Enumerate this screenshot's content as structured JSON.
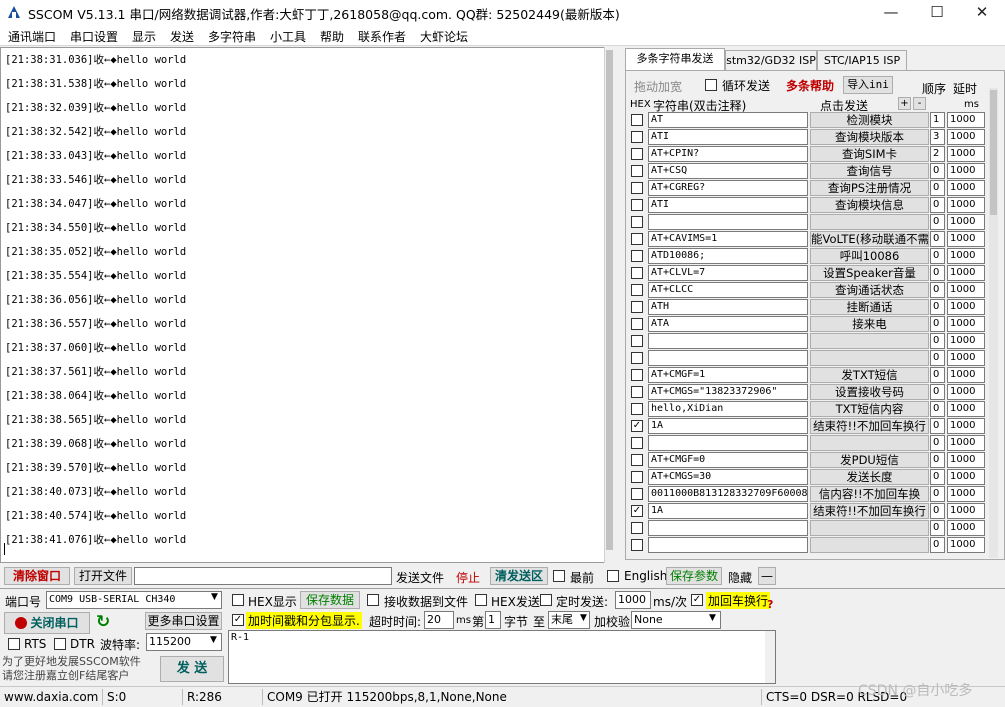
{
  "window": {
    "title": "SSCOM V5.13.1 串口/网络数据调试器,作者:大虾丁丁,2618058@qq.com. QQ群: 52502449(最新版本)",
    "minimize": "—",
    "maximize": "☐",
    "close": "✕"
  },
  "menu": [
    "通讯端口",
    "串口设置",
    "显示",
    "发送",
    "多字符串",
    "小工具",
    "帮助",
    "联系作者",
    "大虾论坛"
  ],
  "receive": {
    "lines": [
      "[21:38:31.036]收←◆hello world",
      "[21:38:31.538]收←◆hello world",
      "[21:38:32.039]收←◆hello world",
      "[21:38:32.542]收←◆hello world",
      "[21:38:33.043]收←◆hello world",
      "[21:38:33.546]收←◆hello world",
      "[21:38:34.047]收←◆hello world",
      "[21:38:34.550]收←◆hello world",
      "[21:38:35.052]收←◆hello world",
      "[21:38:35.554]收←◆hello world",
      "[21:38:36.056]收←◆hello world",
      "[21:38:36.557]收←◆hello world",
      "[21:38:37.060]收←◆hello world",
      "[21:38:37.561]收←◆hello world",
      "[21:38:38.064]收←◆hello world",
      "[21:38:38.565]收←◆hello world",
      "[21:38:39.068]收←◆hello world",
      "[21:38:39.570]收←◆hello world",
      "[21:38:40.073]收←◆hello world",
      "[21:38:40.574]收←◆hello world",
      "[21:38:41.076]收←◆hello world"
    ]
  },
  "tabs": [
    "多条字符串发送",
    "stm32/GD32 ISP",
    "STC/IAP15 ISP"
  ],
  "multi": {
    "drag_label": "拖动加宽",
    "loop_send": "循环发送",
    "help": "多条帮助",
    "import_ini": "导入ini",
    "order": "顺序",
    "delay": "延时",
    "hex_header": "HEX",
    "string_header": "字符串(双击注释)",
    "click_send": "点击发送",
    "plus": "+",
    "minus": "-",
    "ms": "ms",
    "rows": [
      {
        "checked": false,
        "cmd": "AT",
        "btn": "检测模块",
        "seq": "1",
        "delay": "1000"
      },
      {
        "checked": false,
        "cmd": "ATI",
        "btn": "查询模块版本",
        "seq": "3",
        "delay": "1000"
      },
      {
        "checked": false,
        "cmd": "AT+CPIN?",
        "btn": "查询SIM卡",
        "seq": "2",
        "delay": "1000"
      },
      {
        "checked": false,
        "cmd": "AT+CSQ",
        "btn": "查询信号",
        "seq": "0",
        "delay": "1000"
      },
      {
        "checked": false,
        "cmd": "AT+CGREG?",
        "btn": "查询PS注册情况",
        "seq": "0",
        "delay": "1000"
      },
      {
        "checked": false,
        "cmd": "ATI",
        "btn": "查询模块信息",
        "seq": "0",
        "delay": "1000"
      },
      {
        "checked": false,
        "cmd": "",
        "btn": "",
        "seq": "0",
        "delay": "1000"
      },
      {
        "checked": false,
        "cmd": "AT+CAVIMS=1",
        "btn": "能VoLTE(移动联通不需",
        "seq": "0",
        "delay": "1000"
      },
      {
        "checked": false,
        "cmd": "ATD10086;",
        "btn": "呼叫10086",
        "seq": "0",
        "delay": "1000"
      },
      {
        "checked": false,
        "cmd": "AT+CLVL=7",
        "btn": "设置Speaker音量",
        "seq": "0",
        "delay": "1000"
      },
      {
        "checked": false,
        "cmd": "AT+CLCC",
        "btn": "查询通话状态",
        "seq": "0",
        "delay": "1000"
      },
      {
        "checked": false,
        "cmd": "ATH",
        "btn": "挂断通话",
        "seq": "0",
        "delay": "1000"
      },
      {
        "checked": false,
        "cmd": "ATA",
        "btn": "接来电",
        "seq": "0",
        "delay": "1000"
      },
      {
        "checked": false,
        "cmd": "",
        "btn": "",
        "seq": "0",
        "delay": "1000"
      },
      {
        "checked": false,
        "cmd": "",
        "btn": "",
        "seq": "0",
        "delay": "1000"
      },
      {
        "checked": false,
        "cmd": "AT+CMGF=1",
        "btn": "发TXT短信",
        "seq": "0",
        "delay": "1000"
      },
      {
        "checked": false,
        "cmd": "AT+CMGS=\"13823372906\"",
        "btn": "设置接收号码",
        "seq": "0",
        "delay": "1000"
      },
      {
        "checked": false,
        "cmd": "hello,XiDian",
        "btn": "TXT短信内容",
        "seq": "0",
        "delay": "1000"
      },
      {
        "checked": true,
        "cmd": "1A",
        "btn": "结束符!!不加回车换行",
        "seq": "0",
        "delay": "1000"
      },
      {
        "checked": false,
        "cmd": "",
        "btn": "",
        "seq": "0",
        "delay": "1000"
      },
      {
        "checked": false,
        "cmd": "AT+CMGF=0",
        "btn": "发PDU短信",
        "seq": "0",
        "delay": "1000"
      },
      {
        "checked": false,
        "cmd": "AT+CMGS=30",
        "btn": "发送长度",
        "seq": "0",
        "delay": "1000"
      },
      {
        "checked": false,
        "cmd": "0011000B813128332709F60008.",
        "btn": "信内容!!不加回车换",
        "seq": "0",
        "delay": "1000"
      },
      {
        "checked": true,
        "cmd": "1A",
        "btn": "结束符!!不加回车换行",
        "seq": "0",
        "delay": "1000"
      },
      {
        "checked": false,
        "cmd": "",
        "btn": "",
        "seq": "0",
        "delay": "1000"
      },
      {
        "checked": false,
        "cmd": "",
        "btn": "",
        "seq": "0",
        "delay": "1000"
      }
    ]
  },
  "toolbar": {
    "clear_window": "清除窗口",
    "open_file": "打开文件",
    "send_file": "发送文件",
    "stop": "停止",
    "clear_send": "清发送区",
    "latest": "最前",
    "english": "English",
    "save_params": "保存参数",
    "hide": "隐藏",
    "dash": "—"
  },
  "settings": {
    "port_label": "端口号",
    "port_value": "COM9 USB-SERIAL CH340",
    "more_settings": "更多串口设置",
    "hex_display": "HEX显示",
    "save_data": "保存数据",
    "recv_to_file": "接收数据到文件",
    "hex_send": "HEX发送",
    "timed_send": "定时发送:",
    "timed_value": "1000",
    "ms_per": "ms/次",
    "add_crlf": "加回车换行",
    "close_port": "关闭串口",
    "timestamp": "加时间戳和分包显示.",
    "timeout_label": "超时时间:",
    "timeout_value": "20",
    "ms": "ms",
    "di": "第",
    "byte_start": "1",
    "byte_label": "字节",
    "to": "至",
    "end_value": "末尾",
    "checksum_label": "加校验",
    "checksum_value": "None",
    "rts": "RTS",
    "dtr": "DTR",
    "baud_label": "波特率:",
    "baud_value": "115200",
    "send_text": "R-1",
    "promo": "为了更好地发展SSCOM软件\n请您注册嘉立创F结尾客户",
    "send_button": "发 送"
  },
  "status": {
    "site": "www.daxia.com",
    "sent": "S:0",
    "received": "R:286",
    "port_status": "COM9 已打开  115200bps,8,1,None,None",
    "lines": "CTS=0 DSR=0 RLSD=0"
  },
  "watermark": "CSDN @自小吃多"
}
